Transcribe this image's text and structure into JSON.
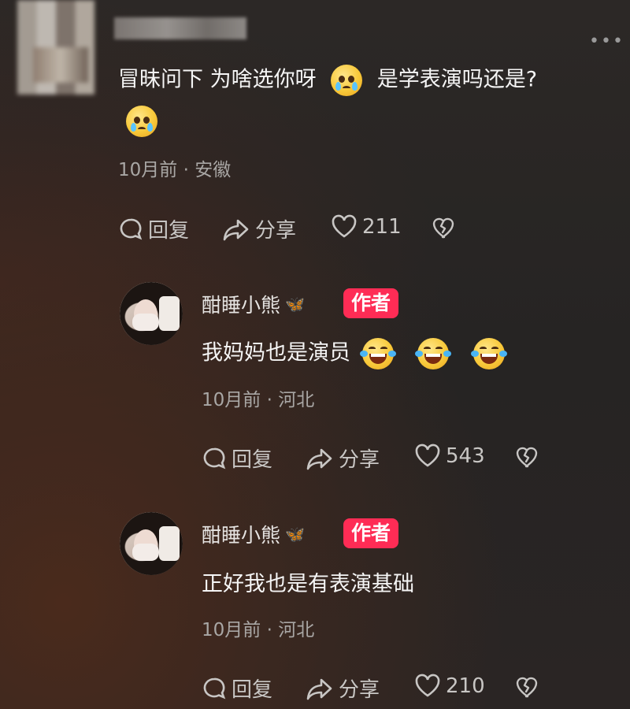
{
  "top_comment": {
    "text_part1": "冒昧问下 为啥选你呀",
    "text_part2": "是学表演吗还是?",
    "emoji": "pleading-face-emoji",
    "meta": "10月前 · 安徽",
    "actions": {
      "reply_label": "回复",
      "share_label": "分享",
      "like_count": "211"
    }
  },
  "replies": [
    {
      "author_name": "酣睡小熊",
      "author_badge": "作者",
      "text": "我妈妈也是演员",
      "emojis": [
        "rolling-laughing-emoji",
        "rolling-laughing-emoji",
        "rolling-laughing-emoji"
      ],
      "meta": "10月前 · 河北",
      "actions": {
        "reply_label": "回复",
        "share_label": "分享",
        "like_count": "543"
      }
    },
    {
      "author_name": "酣睡小熊",
      "author_badge": "作者",
      "text": "正好我也是有表演基础",
      "meta": "10月前 · 河北",
      "actions": {
        "reply_label": "回复",
        "share_label": "分享",
        "like_count": "210"
      }
    }
  ],
  "colors": {
    "badge": "#fe2c55",
    "meta_text": "#a9a7a5",
    "verified_butterfly": "#6fb6ff"
  }
}
